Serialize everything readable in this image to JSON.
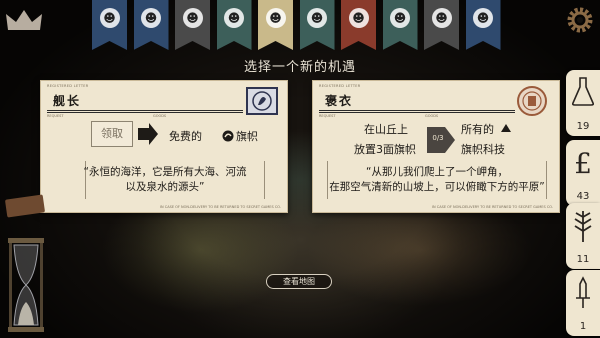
{
  "title": "选择一个新的机遇",
  "colors": {
    "card_bg": "#efe6d0",
    "banners": [
      "#2f4a6e",
      "#2f4a6e",
      "#4a4a4a",
      "#3d5f5a",
      "#c9b98a",
      "#3d5f5a",
      "#8a3b2c",
      "#3d5f5a",
      "#4a4a4a",
      "#2f4a6e"
    ]
  },
  "banners": [
    {
      "icon": "figure-icon"
    },
    {
      "icon": "figure-icon"
    },
    {
      "icon": "figure-icon"
    },
    {
      "icon": "figure-icon"
    },
    {
      "icon": "figure-icon"
    },
    {
      "icon": "figure-icon"
    },
    {
      "icon": "figure-icon"
    },
    {
      "icon": "figure-icon"
    },
    {
      "icon": "figure-icon"
    },
    {
      "icon": "figure-icon"
    }
  ],
  "cards": [
    {
      "registered_label": "REGISTERED LETTER",
      "name": "舰长",
      "request_label": "REQUEST",
      "goods_label": "GOODS",
      "claim_label": "领取",
      "goods_text": "免费的",
      "goods_item": "旗帜",
      "quote_line1": "“永恒的海洋，它是所有大海、河流",
      "quote_line2": "以及泉水的源头”",
      "footer": "IN CASE OF NON-DELIVERY TO BE RETURNED TO SECRET GAMES CO."
    },
    {
      "registered_label": "REGISTERED LETTER",
      "name": "褒衣",
      "request_label": "REQUEST",
      "goods_label": "GOODS",
      "req_line1": "在山丘上",
      "req_line2": "放置3面旗帜",
      "progress": "0/3",
      "goods_line1": "所有的",
      "goods_line2": "旗帜科技",
      "quote_line1": "“从那儿我们爬上了一个岬角，",
      "quote_line2": "在那空气清新的山坡上，可以俯瞰下方的平原”",
      "footer": "IN CASE OF NON-DELIVERY TO BE RETURNED TO SECRET GAMES CO."
    }
  ],
  "resources": [
    {
      "icon": "flask-icon",
      "count": "19"
    },
    {
      "icon": "pound-icon",
      "count": "43"
    },
    {
      "icon": "wheat-icon",
      "count": "11"
    },
    {
      "icon": "sword-icon",
      "count": "1"
    }
  ],
  "view_map_label": "查看地图"
}
